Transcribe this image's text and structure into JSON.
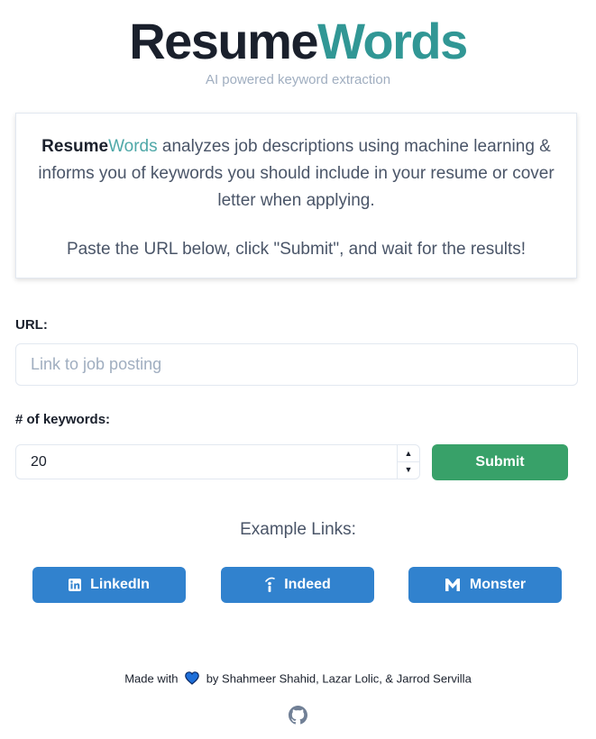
{
  "header": {
    "logo_part1": "Resume",
    "logo_part2": "Words",
    "tagline": "AI powered keyword extraction"
  },
  "info": {
    "brand_part1": "Resume",
    "brand_part2": "Words",
    "description": " analyzes job descriptions using machine learning & informs you of keywords you should include in your resume or cover letter when applying.",
    "instruction": "Paste the URL below, click \"Submit\", and wait for the results!"
  },
  "form": {
    "url_label": "URL:",
    "url_placeholder": "Link to job posting",
    "url_value": "",
    "keywords_label": "# of keywords:",
    "keywords_value": "20",
    "submit_label": "Submit"
  },
  "examples": {
    "title": "Example Links:",
    "buttons": [
      {
        "label": "LinkedIn",
        "icon": "linkedin-icon"
      },
      {
        "label": "Indeed",
        "icon": "indeed-icon"
      },
      {
        "label": "Monster",
        "icon": "monster-icon"
      }
    ]
  },
  "footer": {
    "made_with": "Made with",
    "credits": "by Shahmeer Shahid, Lazar Lolic, & Jarrod Servilla",
    "heart_icon": "heart-icon",
    "repo_icon": "github-icon"
  },
  "colors": {
    "brand_dark": "#1a202c",
    "brand_teal": "#319795",
    "submit": "#38a169",
    "example_buttons": "#3182ce"
  }
}
